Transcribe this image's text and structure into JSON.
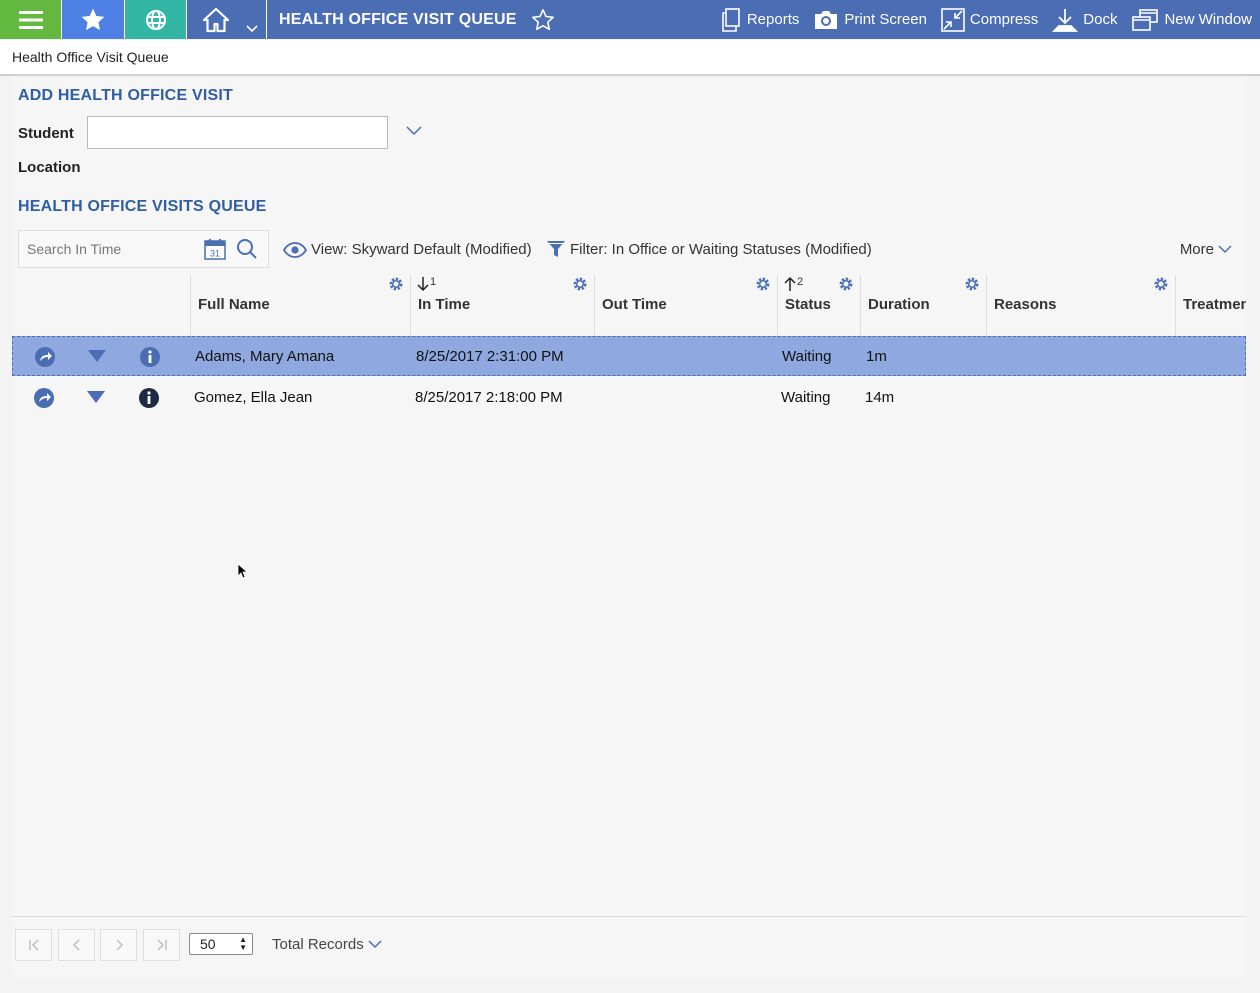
{
  "topbar": {
    "title": "HEALTH OFFICE VISIT QUEUE",
    "actions": [
      {
        "label": "Reports",
        "icon": "reports-icon"
      },
      {
        "label": "Print Screen",
        "icon": "camera-icon"
      },
      {
        "label": "Compress",
        "icon": "compress-icon"
      },
      {
        "label": "Dock",
        "icon": "dock-icon"
      },
      {
        "label": "New Window",
        "icon": "new-window-icon"
      }
    ]
  },
  "breadcrumb": "Health Office Visit Queue",
  "add_section": {
    "title": "ADD HEALTH OFFICE VISIT",
    "student_label": "Student",
    "location_label": "Location"
  },
  "queue": {
    "title": "HEALTH OFFICE VISITS QUEUE",
    "search_placeholder": "Search In Time",
    "view_label": "View: Skyward Default (Modified)",
    "filter_label": "Filter: In Office or Waiting Statuses (Modified)",
    "more_label": "More",
    "columns": [
      {
        "label": "Full Name",
        "sort": ""
      },
      {
        "label": "In Time",
        "sort": "1"
      },
      {
        "label": "Out Time",
        "sort": ""
      },
      {
        "label": "Status",
        "sort": "2"
      },
      {
        "label": "Duration",
        "sort": ""
      },
      {
        "label": "Reasons",
        "sort": ""
      },
      {
        "label": "Treatmen",
        "sort": ""
      }
    ],
    "rows": [
      {
        "name": "Adams, Mary Amana",
        "in_time": "8/25/2017 2:31:00 PM",
        "out_time": "",
        "status": "Waiting",
        "duration": "1m",
        "reasons": "",
        "selected": true
      },
      {
        "name": "Gomez, Ella Jean",
        "in_time": "8/25/2017 2:18:00 PM",
        "out_time": "",
        "status": "Waiting",
        "duration": "14m",
        "reasons": "",
        "selected": false
      }
    ]
  },
  "pager": {
    "page_size": "50",
    "total_label": "Total Records"
  },
  "colors": {
    "topbar": "#4a6db4",
    "menu_block": "#63b83f",
    "fav_block": "#4d7fe5",
    "globe_block": "#34b6a6",
    "section_title": "#2f5ea6",
    "selected_row": "#8fa9e0"
  }
}
